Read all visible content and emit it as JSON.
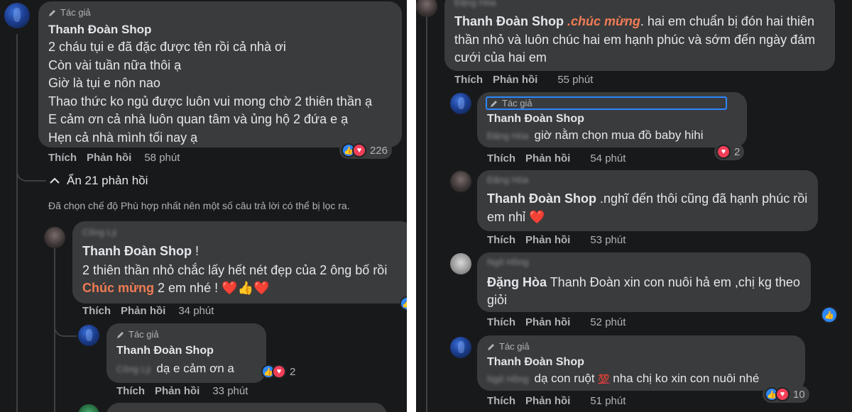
{
  "left": {
    "c1": {
      "author_tag": "Tác giả",
      "name": "Thanh Đoàn Shop",
      "lines": [
        "2 cháu tụi e đã đặc được tên rồi cả nhà ơi",
        "Còn vài tuần nữa thôi ạ",
        "Giờ là tụi e nôn nao",
        "Thao thức ko ngủ được luôn vui mong chờ 2 thiên thần ạ",
        "E cảm ơn cả nhà luôn quan tâm và ủng hộ 2 đứa e ạ",
        "Hẹn cả nhà mình tối nay ạ"
      ],
      "reaction_count": "226",
      "like": "Thích",
      "reply": "Phản hồi",
      "time": "58 phút"
    },
    "hide_replies": "Ẩn 21 phản hồi",
    "filter_note": "Đã chọn chế độ Phù hợp nhất nên một số câu trả lời có thể bị lọc ra.",
    "c2": {
      "name_blurred": "Công Lý",
      "line1_name": "Thanh Đoàn Shop",
      "line1_rest": " !",
      "line2": "2 thiên thần nhỏ chắc lấy hết nét đẹp của 2 ông bố rồi",
      "line3_orange": "Chúc mừng",
      "line3_rest": " 2 em nhé ! ",
      "like": "Thích",
      "reply": "Phản hồi",
      "time": "34 phút"
    },
    "c3": {
      "author_tag": "Tác giả",
      "name": "Thanh Đoàn Shop",
      "mention_blurred": "Công Lý",
      "text": "dạ e cảm ơn a",
      "reaction_count": "2",
      "like": "Thích",
      "reply": "Phản hồi",
      "time": "33 phút"
    }
  },
  "right": {
    "c1": {
      "name_blurred": "Đặng Hòa",
      "line1_name": "Thanh Đoàn Shop",
      "line1_orange": " .chúc mừng",
      "line1_rest": ". hai em chuẩn bị đón hai thiên",
      "line2": "thần nhỏ và luôn chúc hai em hạnh phúc và sớm đến ngày đám",
      "line3": "cưới của hai em",
      "like": "Thích",
      "reply": "Phản hồi",
      "time": "55 phút"
    },
    "c2": {
      "author_tag": "Tác giả",
      "name": "Thanh Đoàn Shop",
      "mention_blurred": "Đặng Hòa",
      "text": "giờ nằm chọn mua đồ baby hihi",
      "reaction_count": "2",
      "like": "Thích",
      "reply": "Phản hồi",
      "time": "54 phút"
    },
    "c3": {
      "name_blurred": "Đặng Hòa",
      "line1_name": "Thanh Đoàn Shop",
      "line1_rest": " .nghĩ đến thôi cũng đã hạnh phúc rồi",
      "line2": "em nhỉ",
      "like": "Thích",
      "reply": "Phản hồi",
      "time": "53 phút"
    },
    "c4": {
      "name_blurred": "Ngô Hồng",
      "line1_name": "Đặng Hòa",
      "line1_rest": " Thanh Đoàn xin con nuôi hả em ,chị kg theo",
      "line2": "giỏi",
      "like": "Thích",
      "reply": "Phản hồi",
      "time": "52 phút"
    },
    "c5": {
      "author_tag": "Tác giả",
      "name": "Thanh Đoàn Shop",
      "mention_blurred": "Ngô Hồng",
      "text_before": "dạ con ruột ",
      "emoji": "💯",
      "text_after": " nha chị ko xin con nuôi nhé",
      "reaction_count": "10",
      "like": "Thích",
      "reply": "Phản hồi",
      "time": "51 phút"
    }
  },
  "colors": {
    "background": "#18191a",
    "bubble": "#3a3b3c",
    "text": "#e4e6eb",
    "muted": "#b0b3b8",
    "accent_orange": "#f07c55",
    "like_blue": "#2d88ff",
    "love_red": "#f33e58"
  }
}
